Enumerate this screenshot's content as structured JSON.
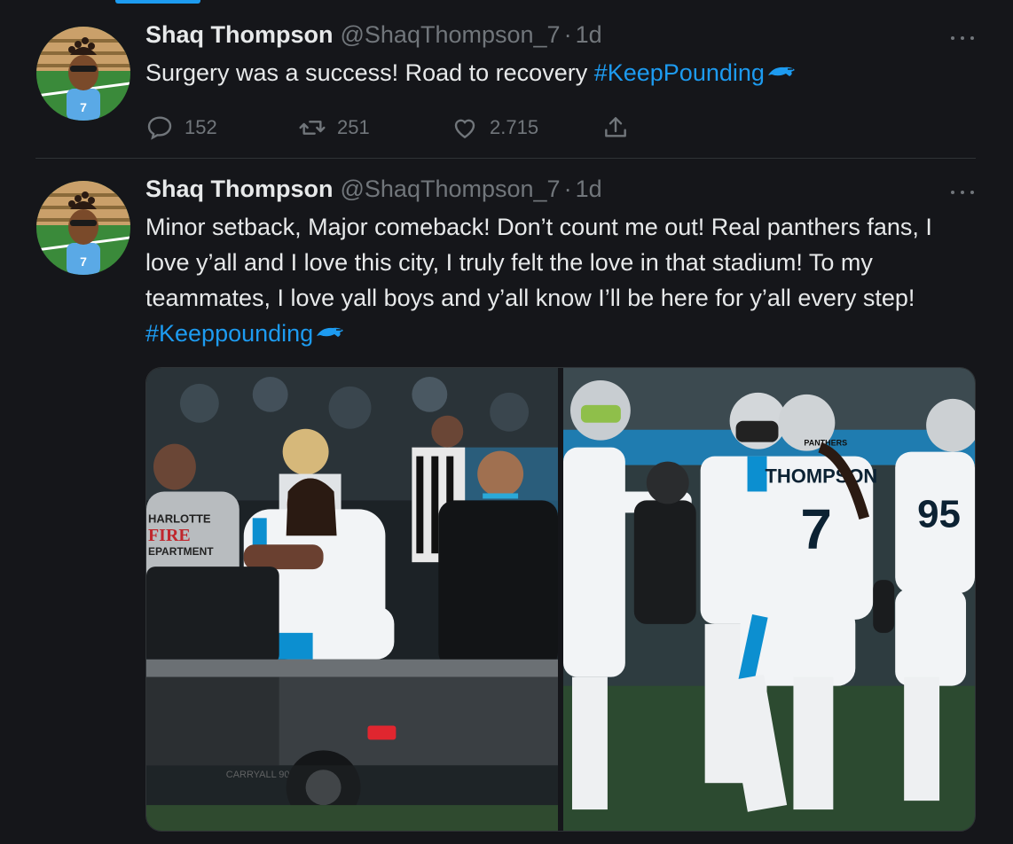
{
  "tweets": [
    {
      "name": "Shaq Thompson",
      "handle": "@ShaqThompson_7",
      "separator": "·",
      "time": "1d",
      "text_before": "Surgery was a success! Road to recovery ",
      "hashtag": "#KeepPounding",
      "replies": "152",
      "retweets": "251",
      "likes": "2.715"
    },
    {
      "name": "Shaq Thompson",
      "handle": "@ShaqThompson_7",
      "separator": "·",
      "time": "1d",
      "text_before": "Minor setback, Major comeback! Don’t count me out! Real panthers fans, I love y’all and I love this city, I truly felt the love in that stadium! To my teammates, I love yall boys and y’all know I’ll be here for y’all every step! ",
      "hashtag": "#Keeppounding",
      "photos": {
        "left_sign": "HARLOTTE FIRE EPARTMENT",
        "left_cart": "CARRYALL 900",
        "right_jersey_name": "THOMPSON",
        "right_jersey_number": "7",
        "right_other_number": "95",
        "helmet_text": "PANTHERS"
      }
    }
  ],
  "icons": {
    "reply": "reply-icon",
    "retweet": "retweet-icon",
    "like": "heart-icon",
    "share": "share-icon",
    "more": "more-icon",
    "emoji": "panther-emoji-icon"
  },
  "colors": {
    "background": "#15161a",
    "accent": "#1d9bf0",
    "muted": "#71767b",
    "text": "#e7e9ea"
  }
}
